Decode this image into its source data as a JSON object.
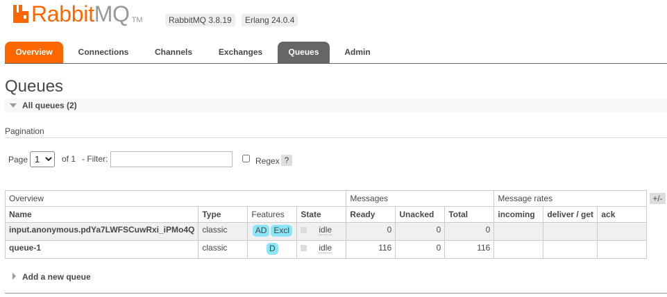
{
  "header": {
    "logo_rabbit": "Rabbit",
    "logo_mq": "MQ",
    "logo_tm": "TM",
    "rabbitmq_version": "RabbitMQ 3.8.19",
    "erlang_version": "Erlang 24.0.4"
  },
  "nav": {
    "tabs": [
      {
        "label": "Overview"
      },
      {
        "label": "Connections"
      },
      {
        "label": "Channels"
      },
      {
        "label": "Exchanges"
      },
      {
        "label": "Queues"
      },
      {
        "label": "Admin"
      }
    ],
    "active": "Queues"
  },
  "page": {
    "title": "Queues",
    "section_label": "All queues (2)"
  },
  "pagination": {
    "heading": "Pagination",
    "page_label": "Page",
    "page_value": "1",
    "of_label": "of 1",
    "filter_label": "- Filter:",
    "filter_value": "",
    "regex_label": "Regex",
    "help_label": "?"
  },
  "table": {
    "groups": {
      "overview": "Overview",
      "messages": "Messages",
      "message_rates": "Message rates"
    },
    "columns": {
      "name": "Name",
      "type": "Type",
      "features": "Features",
      "state": "State",
      "ready": "Ready",
      "unacked": "Unacked",
      "total": "Total",
      "incoming": "incoming",
      "deliver_get": "deliver / get",
      "ack": "ack"
    },
    "toggle_columns": "+/-",
    "rows": [
      {
        "name": "input.anonymous.pdYa7LWFSCuwRxi_iPMo4Q",
        "type": "classic",
        "features": [
          "AD",
          "Excl"
        ],
        "state": "idle",
        "ready": "0",
        "unacked": "0",
        "total": "0",
        "incoming": "",
        "deliver_get": "",
        "ack": ""
      },
      {
        "name": "queue-1",
        "type": "classic",
        "features": [
          "D"
        ],
        "state": "idle",
        "ready": "116",
        "unacked": "0",
        "total": "116",
        "incoming": "",
        "deliver_get": "",
        "ack": ""
      }
    ]
  },
  "add_queue": {
    "label": "Add a new queue"
  },
  "colors": {
    "brand_orange": "#ff6600",
    "active_tab": "#666666",
    "feature_badge": "#8ce4f7"
  },
  "icons": {
    "logo": "rabbitmq-logo-icon",
    "section_toggle": "triangle-down-icon",
    "add_toggle": "triangle-right-icon",
    "state_indicator": "status-square-icon"
  }
}
